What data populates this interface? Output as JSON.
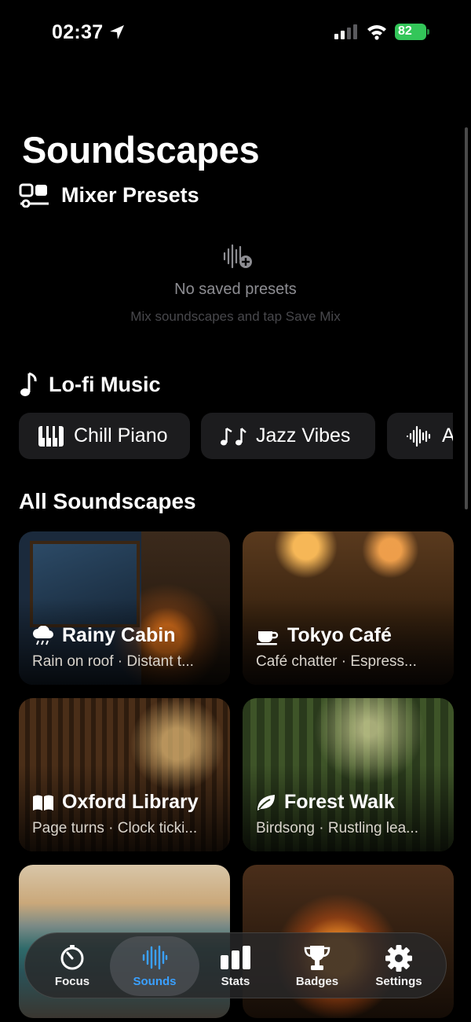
{
  "status_bar": {
    "time": "02:37",
    "battery": "82"
  },
  "page_title": "Soundscapes",
  "mixer": {
    "title": "Mixer Presets",
    "empty_title": "No saved presets",
    "empty_subtitle": "Mix soundscapes and tap Save Mix"
  },
  "lofi": {
    "title": "Lo-fi Music",
    "chips": [
      {
        "label": "Chill Piano",
        "icon": "piano-icon"
      },
      {
        "label": "Jazz Vibes",
        "icon": "music-notes-icon"
      },
      {
        "label": "A",
        "icon": "waveform-icon"
      }
    ]
  },
  "all": {
    "title": "All Soundscapes",
    "cards": [
      {
        "title": "Rainy Cabin",
        "subtitle": "Rain on roof · Distant t...",
        "icon": "cloud-rain-icon"
      },
      {
        "title": "Tokyo Café",
        "subtitle": "Café chatter · Espress...",
        "icon": "coffee-cup-icon"
      },
      {
        "title": "Oxford Library",
        "subtitle": "Page turns · Clock ticki...",
        "icon": "book-icon"
      },
      {
        "title": "Forest Walk",
        "subtitle": "Birdsong · Rustling lea...",
        "icon": "leaf-icon"
      }
    ]
  },
  "tabbar": {
    "tabs": [
      {
        "label": "Focus",
        "icon": "timer-icon"
      },
      {
        "label": "Sounds",
        "icon": "waveform-icon",
        "active": true
      },
      {
        "label": "Stats",
        "icon": "bar-chart-icon"
      },
      {
        "label": "Badges",
        "icon": "trophy-icon"
      },
      {
        "label": "Settings",
        "icon": "gear-icon"
      }
    ]
  },
  "colors": {
    "accent": "#3aa0ff",
    "battery": "#33c659",
    "chip_bg": "#1c1c1e"
  }
}
